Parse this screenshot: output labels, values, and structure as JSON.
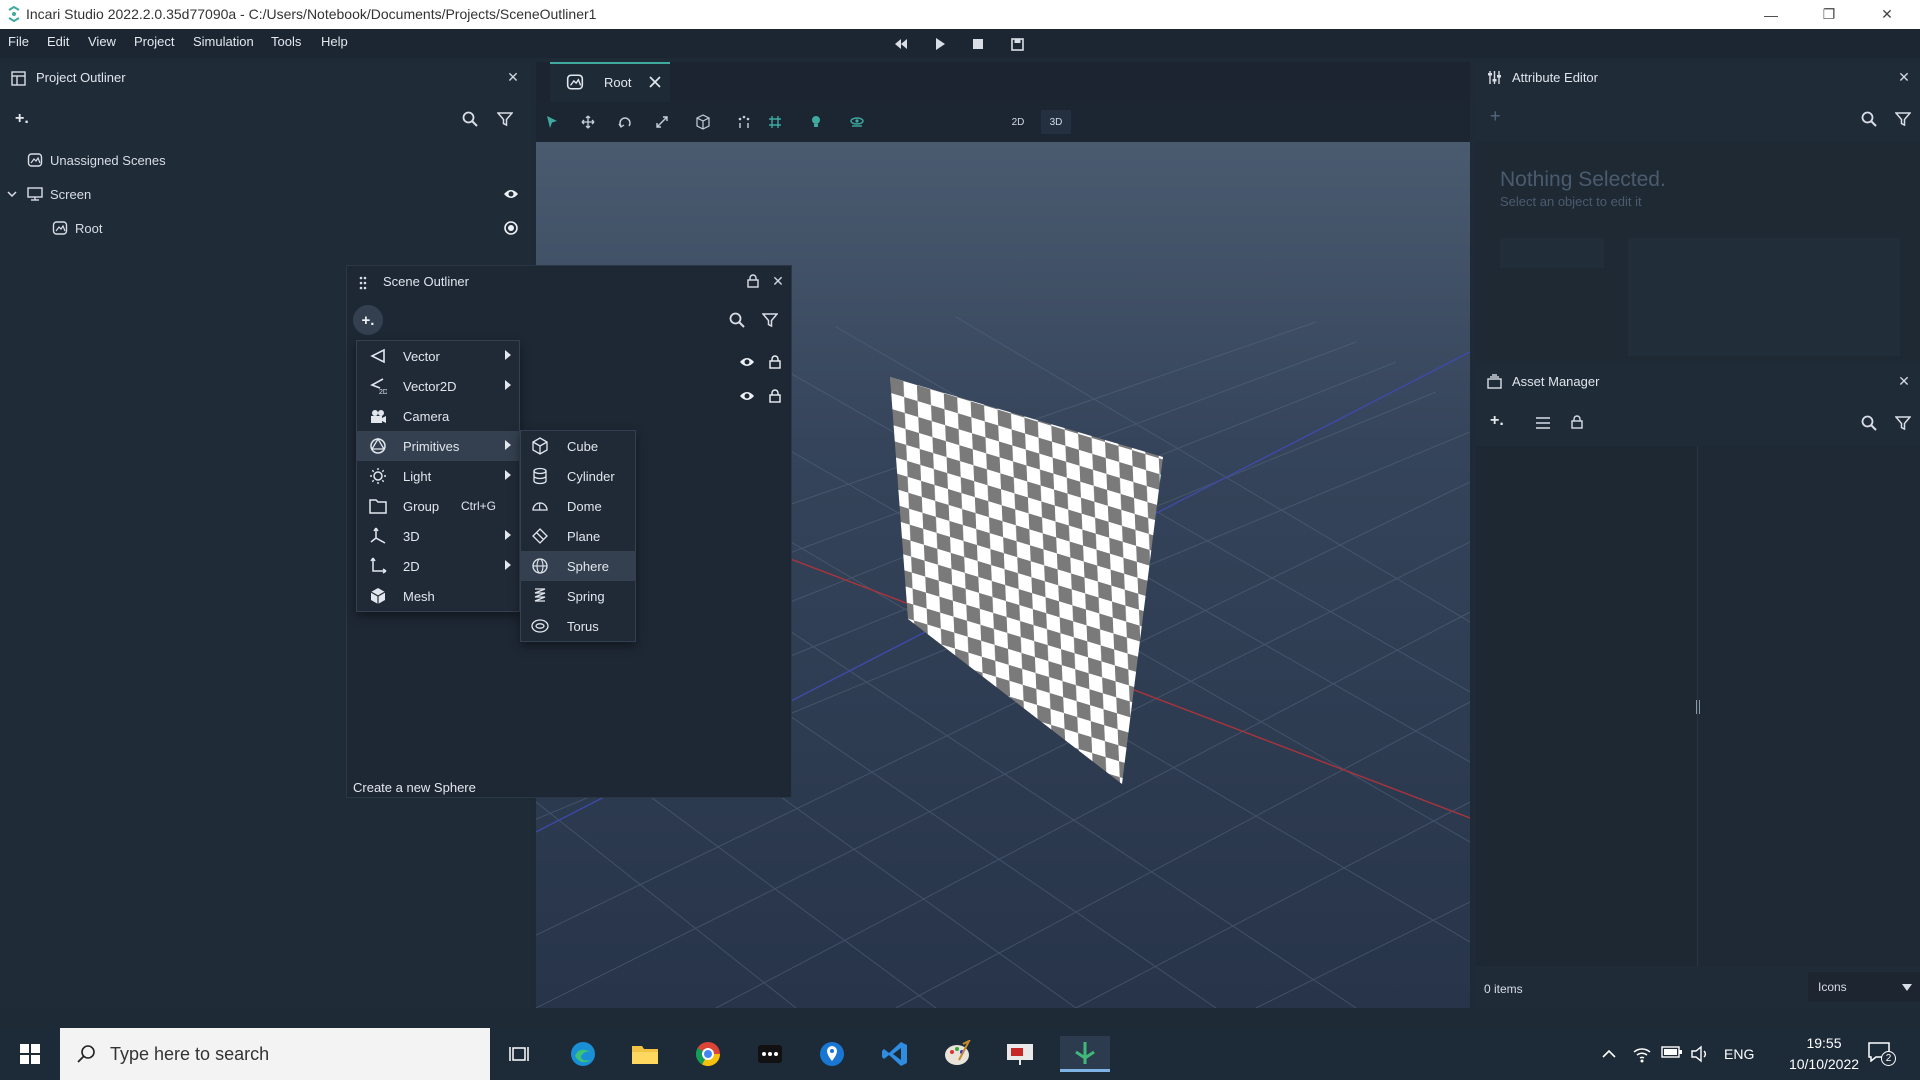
{
  "window": {
    "title": "Incari Studio 2022.2.0.35d77090a - C:/Users/Notebook/Documents/Projects/SceneOutliner1",
    "minimize": "—",
    "restore": "❐",
    "close": "✕"
  },
  "menubar": {
    "items": [
      "File",
      "Edit",
      "View",
      "Project",
      "Simulation",
      "Tools",
      "Help"
    ]
  },
  "project_outliner": {
    "title": "Project Outliner",
    "add_label": "+.",
    "tree": [
      {
        "label": "Unassigned Scenes",
        "icon": "scene-icon"
      },
      {
        "label": "Screen",
        "icon": "monitor-icon"
      },
      {
        "label": "Root",
        "icon": "scene-icon"
      }
    ]
  },
  "viewport": {
    "tab_label": "Root",
    "mode_2d": "2D",
    "mode_3d": "3D"
  },
  "scene_outliner": {
    "title": "Scene Outliner",
    "add_label": "+.",
    "status_text": "Create a new Sphere"
  },
  "add_menu": {
    "items": [
      {
        "label": "Vector",
        "icon": "vector-icon",
        "submenu": true
      },
      {
        "label": "Vector2D",
        "icon": "vector2d-icon",
        "submenu": true
      },
      {
        "label": "Camera",
        "icon": "camera-icon",
        "submenu": false
      },
      {
        "label": "Primitives",
        "icon": "primitives-icon",
        "submenu": true,
        "highlighted": true
      },
      {
        "label": "Light",
        "icon": "light-icon",
        "submenu": true
      },
      {
        "label": "Group",
        "icon": "folder-icon",
        "shortcut": "Ctrl+G",
        "submenu": false
      },
      {
        "label": "3D",
        "icon": "axes-3d-icon",
        "submenu": true
      },
      {
        "label": "2D",
        "icon": "axes-2d-icon",
        "submenu": true
      },
      {
        "label": "Mesh",
        "icon": "mesh-icon",
        "submenu": false
      }
    ]
  },
  "primitives_menu": {
    "items": [
      {
        "label": "Cube",
        "icon": "cube-icon"
      },
      {
        "label": "Cylinder",
        "icon": "cylinder-icon"
      },
      {
        "label": "Dome",
        "icon": "dome-icon"
      },
      {
        "label": "Plane",
        "icon": "plane-icon"
      },
      {
        "label": "Sphere",
        "icon": "sphere-icon",
        "highlighted": true
      },
      {
        "label": "Spring",
        "icon": "spring-icon"
      },
      {
        "label": "Torus",
        "icon": "torus-icon"
      }
    ]
  },
  "attribute_editor": {
    "title": "Attribute Editor",
    "add_label": "+",
    "empty_title": "Nothing Selected.",
    "empty_subtitle": "Select an object to edit it"
  },
  "asset_manager": {
    "title": "Asset Manager",
    "add_label": "+.",
    "count_text": "0 items",
    "view_mode": "Icons"
  },
  "taskbar": {
    "search_placeholder": "Type here to search",
    "language": "ENG",
    "time": "19:55",
    "date": "10/10/2022",
    "notification_count": "2"
  },
  "colors": {
    "accent": "#3fa9a0",
    "panel_bg": "#202b38",
    "viewport_top": "#4a5a6f",
    "menu_highlight": "#34404f"
  }
}
